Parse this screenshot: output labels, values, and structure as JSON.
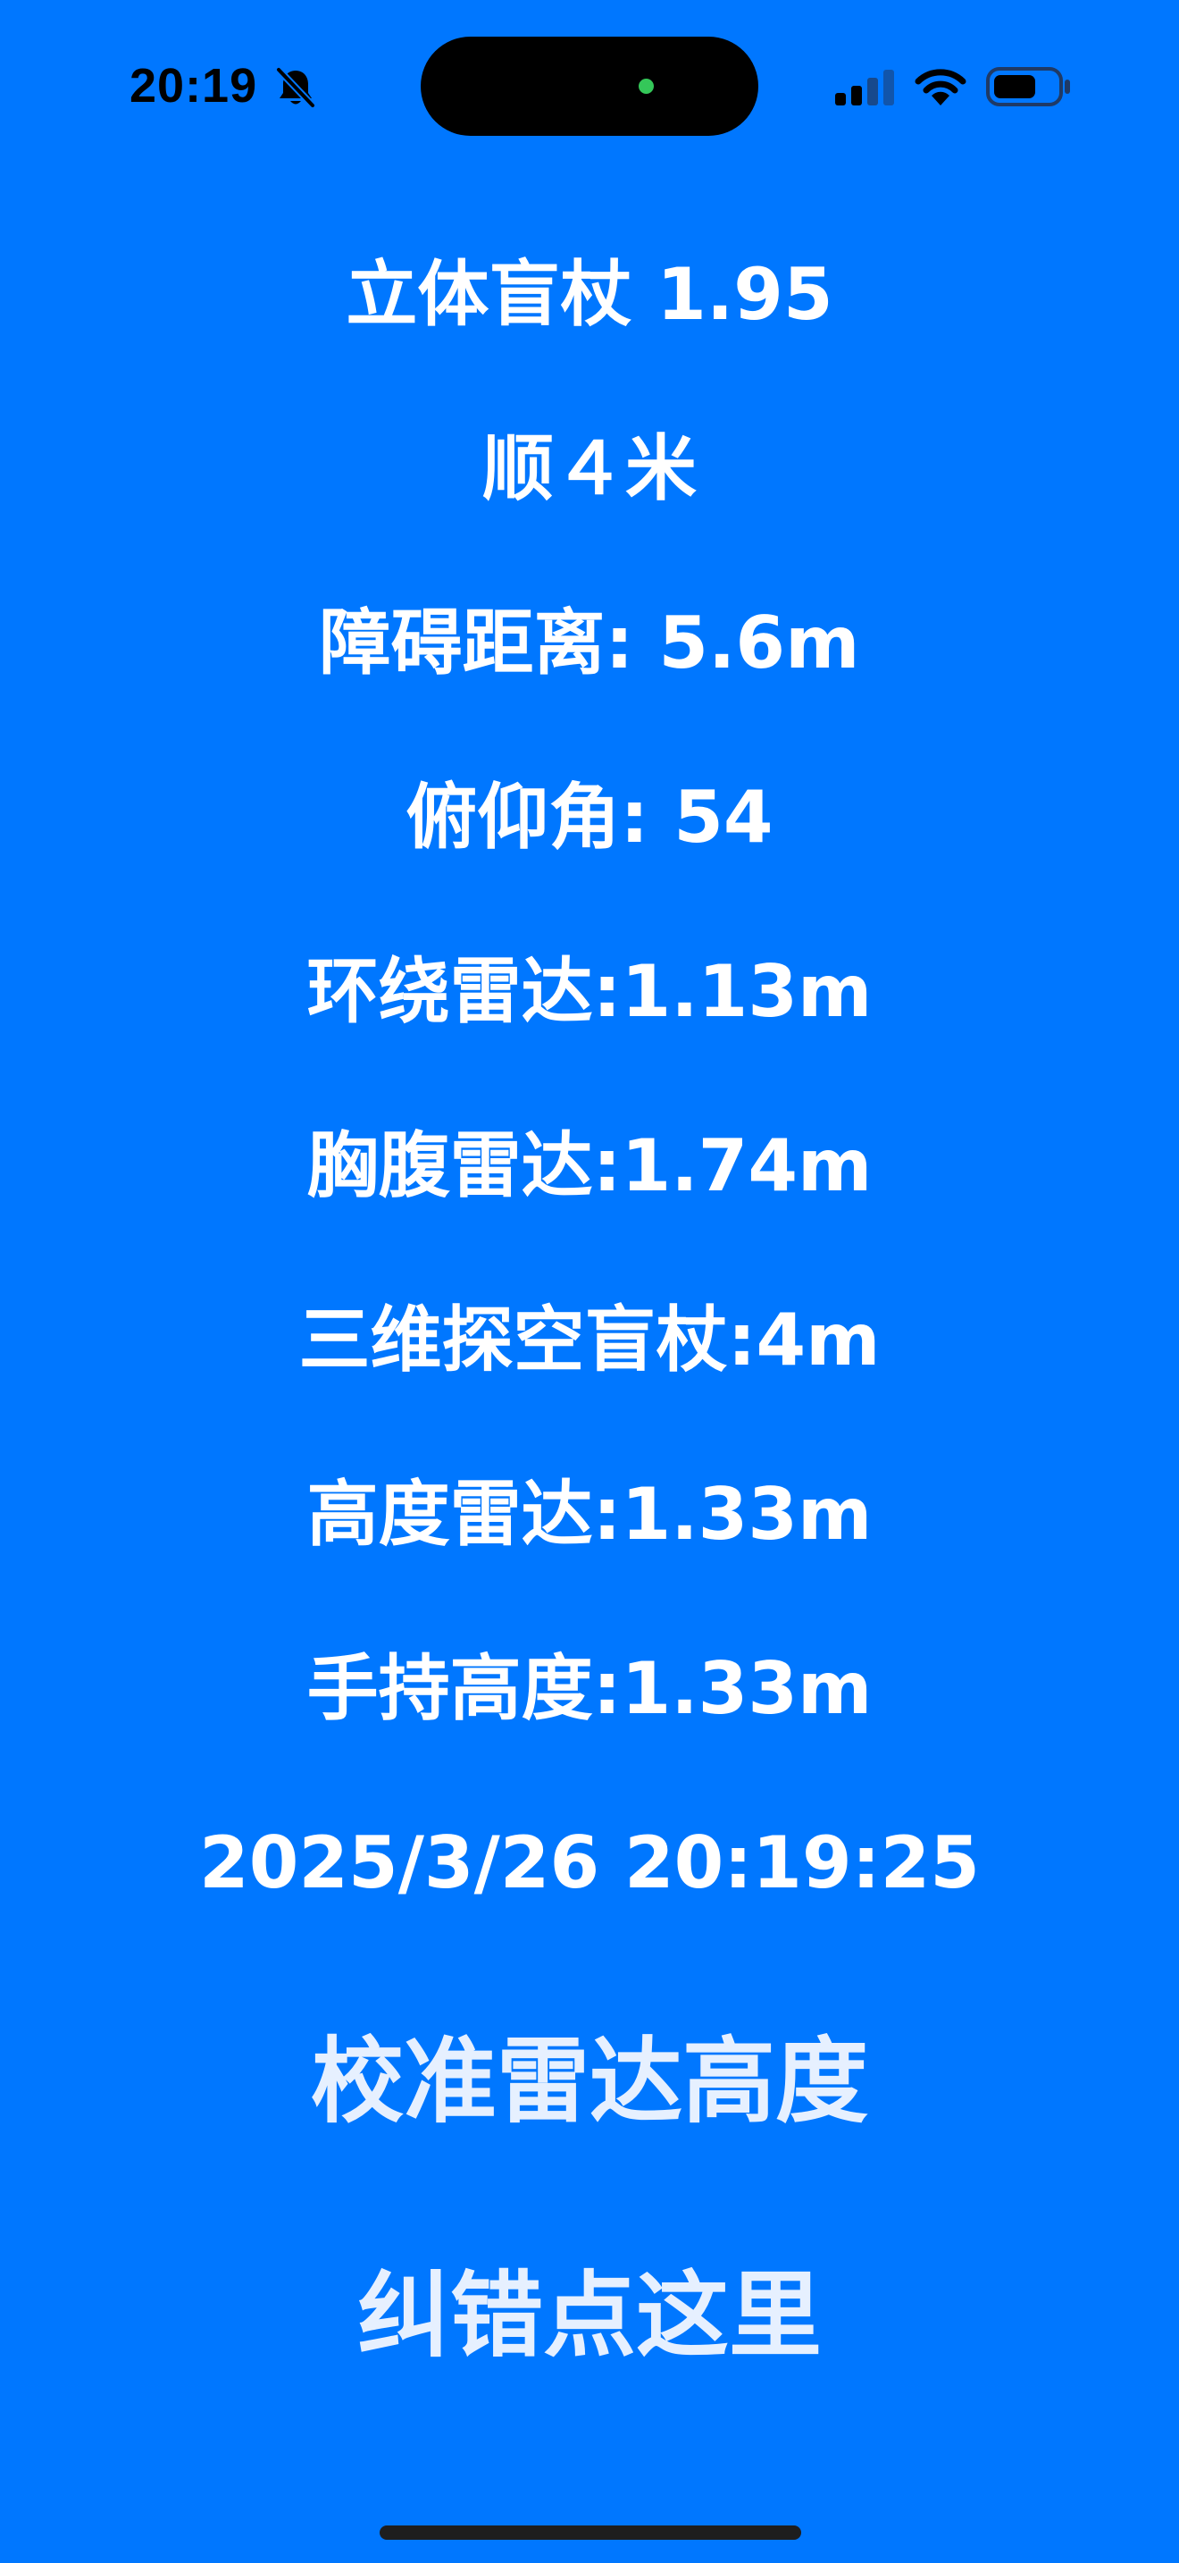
{
  "status_bar": {
    "time": "20:19",
    "icons": [
      "bell-slash-icon",
      "cellular-signal-icon",
      "wifi-icon",
      "battery-icon"
    ],
    "camera_indicator_color": "#34C759"
  },
  "colors": {
    "background": "#0077FF",
    "text": "#FFFFFF",
    "button_text": "#E6F0FF"
  },
  "main": {
    "title": "立体盲杖 1.95",
    "direction": "顺４米",
    "obstacle_distance": "障碍距离: 5.6m",
    "pitch_angle": "俯仰角: 54",
    "surround_radar": "环绕雷达:1.13m",
    "chest_radar": "胸腹雷达:1.74m",
    "cane_3d": "三维探空盲杖:4m",
    "height_radar": "高度雷达:1.33m",
    "handheld_height": "手持高度:1.33m",
    "datetime": "2025/3/26 20:19:25"
  },
  "actions": {
    "calibrate_label": "校准雷达高度",
    "correct_label": "纠错点这里"
  }
}
